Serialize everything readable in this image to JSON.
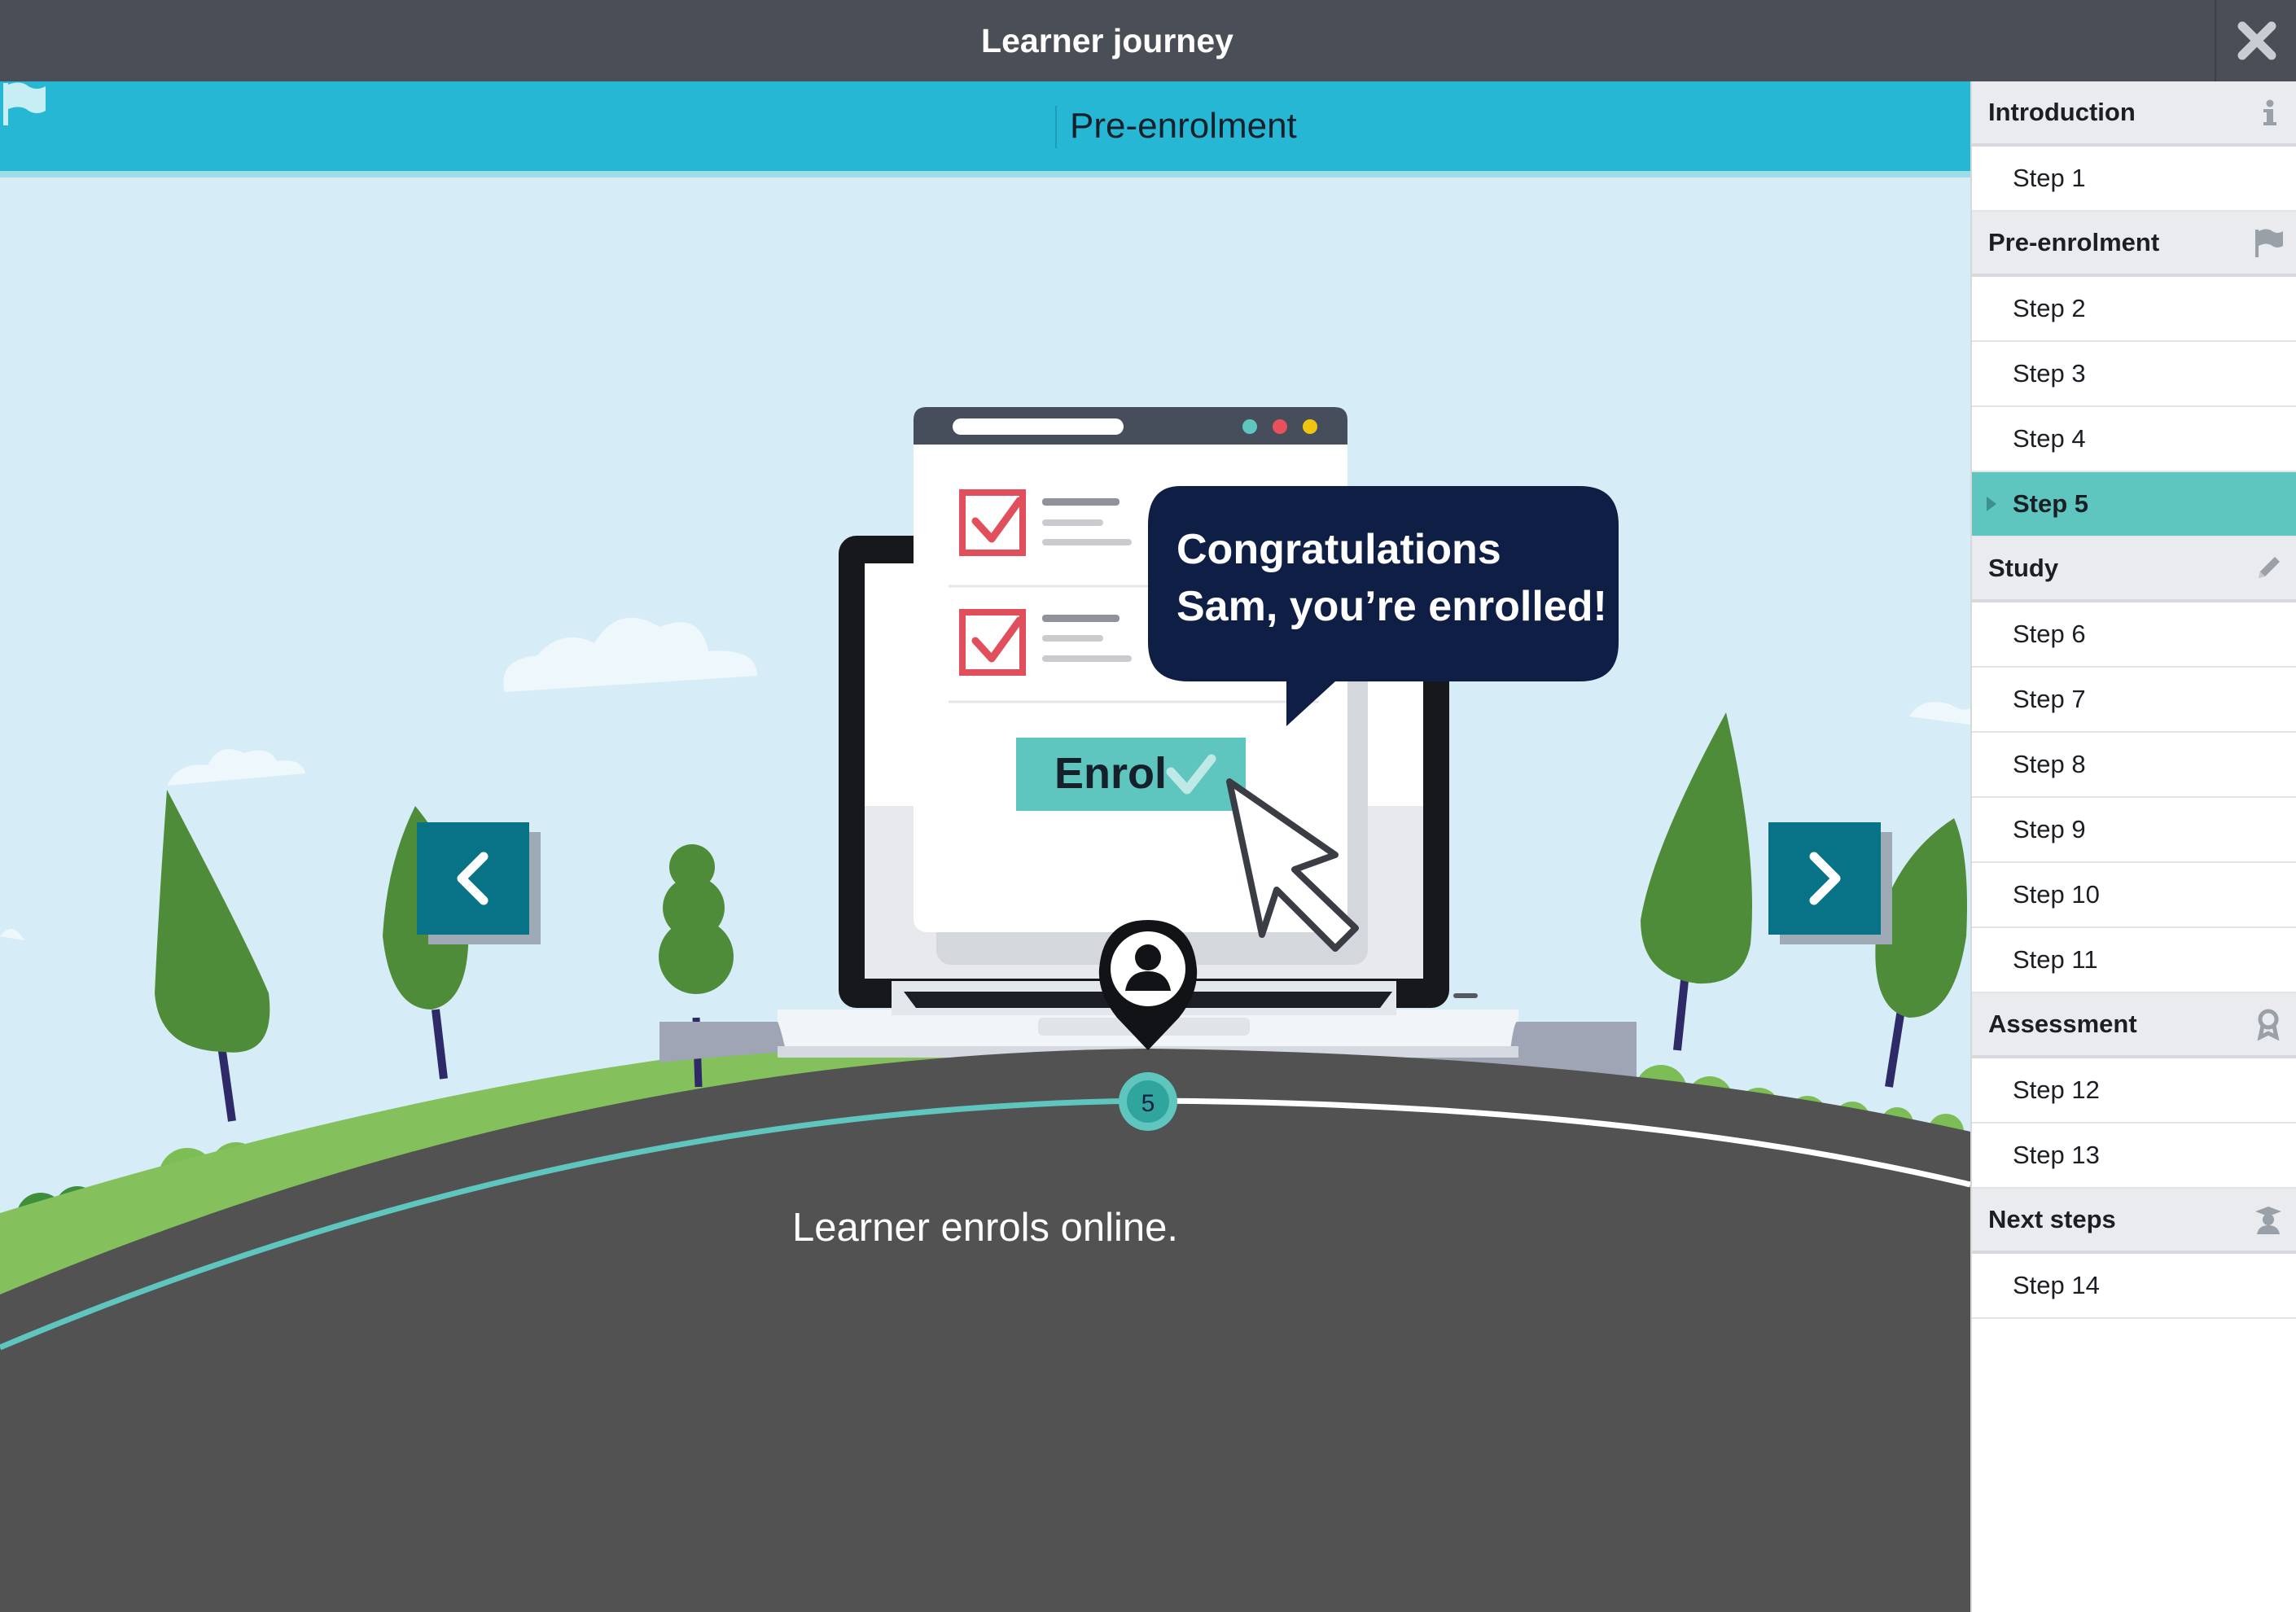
{
  "app": {
    "title": "Learner journey"
  },
  "section": {
    "title": "Pre-enrolment",
    "icon": "flag-icon"
  },
  "illustration": {
    "speech_line1": "Congratulations",
    "speech_line2": "Sam, you’re enrolled!",
    "enrol_button": "Enrol",
    "step_number": "5",
    "caption": "Learner enrols online."
  },
  "sidebar": {
    "sections": [
      {
        "title": "Introduction",
        "icon": "info-icon",
        "steps": [
          "Step 1"
        ]
      },
      {
        "title": "Pre-enrolment",
        "icon": "flag-icon",
        "steps": [
          "Step 2",
          "Step 3",
          "Step 4",
          "Step 5"
        ]
      },
      {
        "title": "Study",
        "icon": "pencil-icon",
        "steps": [
          "Step 6",
          "Step 7",
          "Step 8",
          "Step 9",
          "Step 10",
          "Step 11"
        ]
      },
      {
        "title": "Assessment",
        "icon": "award-icon",
        "steps": [
          "Step 12",
          "Step 13"
        ]
      },
      {
        "title": "Next steps",
        "icon": "graduate-icon",
        "steps": [
          "Step 14"
        ]
      }
    ],
    "active_step": "Step 5"
  },
  "colors": {
    "topbar": "#4a4e57",
    "section_bar": "#26b7d4",
    "active_step": "#5ec6bf",
    "nav_button": "#087287",
    "speech_bubble": "#0f1e45",
    "road": "#525252"
  }
}
